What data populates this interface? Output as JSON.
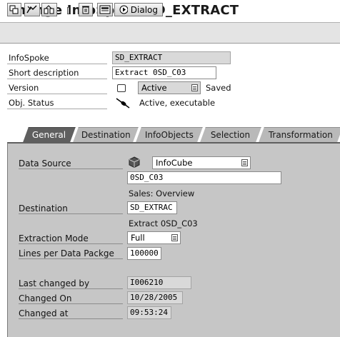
{
  "window": {
    "title": "Change InfoSpoke SD_EXTRACT"
  },
  "toolbar": {
    "dialog_label": "Dialog"
  },
  "header": {
    "infospoke_label": "InfoSpoke",
    "infospoke_value": "SD_EXTRACT",
    "short_desc_label": "Short description",
    "short_desc_value": "Extract 0SD_C03",
    "version_label": "Version",
    "version_value": "Active",
    "version_status": "Saved",
    "obj_status_label": "Obj. Status",
    "obj_status_value": "Active, executable"
  },
  "tabs": [
    {
      "label": "General",
      "active": true
    },
    {
      "label": "Destination",
      "active": false
    },
    {
      "label": "InfoObjects",
      "active": false
    },
    {
      "label": "Selection",
      "active": false
    },
    {
      "label": "Transformation",
      "active": false
    }
  ],
  "general": {
    "data_source_label": "Data Source",
    "data_source_type": "InfoCube",
    "data_source_value": "0SD_C03",
    "data_source_desc": "Sales: Overview",
    "destination_label": "Destination",
    "destination_value": "SD_EXTRAC",
    "destination_desc": "Extract 0SD_C03",
    "extraction_mode_label": "Extraction Mode",
    "extraction_mode_value": "Full",
    "lines_label": "Lines per Data Packge",
    "lines_value": "100000",
    "last_changed_by_label": "Last changed by",
    "last_changed_by_value": "I006210",
    "changed_on_label": "Changed On",
    "changed_on_value": "10/28/2005",
    "changed_at_label": "Changed at",
    "changed_at_value": "09:53:24"
  },
  "icons": [
    "other-object-icon",
    "toggle-change-icon",
    "check-icon",
    "activate-icon",
    "delete-icon",
    "display-log-icon",
    "dialog-icon",
    "infocube-icon",
    "status-connector-icon"
  ],
  "colors": {
    "tab_active": "#5f5f5f",
    "tab_inactive": "#b9b9b9",
    "panel": "#c6c6c6",
    "readonly_field": "#d9d9d9"
  }
}
